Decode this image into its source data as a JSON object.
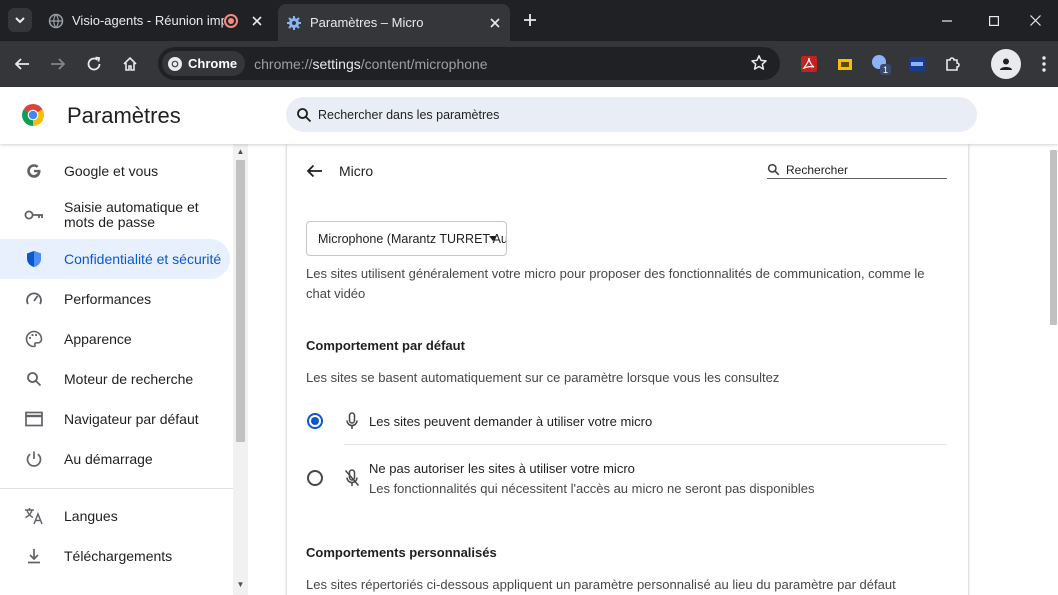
{
  "tabs": [
    {
      "title": "Visio-agents - Réunion impromptue",
      "recording": true
    },
    {
      "title": "Paramètres – Micro",
      "active": true
    }
  ],
  "omnibox": {
    "chip_label": "Chrome",
    "url_scheme": "chrome://",
    "url_host": "settings",
    "url_path": "/content/microphone"
  },
  "extensions": [
    "adobe-pdf",
    "notes",
    "badge-extension",
    "arc-extension",
    "puzzle"
  ],
  "extension_badge": "1",
  "settings": {
    "title": "Paramètres",
    "search_placeholder": "Rechercher dans les paramètres"
  },
  "sidebar": {
    "items": [
      {
        "label": "Google et vous",
        "icon": "google-g-icon"
      },
      {
        "label": "Saisie automatique et mots de passe",
        "icon": "key-icon"
      },
      {
        "label": "Confidentialité et sécurité",
        "icon": "shield-icon",
        "active": true
      },
      {
        "label": "Performances",
        "icon": "speedometer-icon"
      },
      {
        "label": "Apparence",
        "icon": "palette-icon"
      },
      {
        "label": "Moteur de recherche",
        "icon": "search-icon"
      },
      {
        "label": "Navigateur par défaut",
        "icon": "browser-window-icon"
      },
      {
        "label": "Au démarrage",
        "icon": "power-icon"
      },
      {
        "label": "Langues",
        "icon": "translate-icon"
      },
      {
        "label": "Téléchargements",
        "icon": "download-icon"
      }
    ]
  },
  "micro": {
    "title": "Micro",
    "search_placeholder": "Rechercher",
    "device": "Microphone (Marantz TURRET Audio)",
    "description": "Les sites utilisent généralement votre micro pour proposer des fonctionnalités de communication, comme le chat vidéo",
    "default_heading": "Comportement par défaut",
    "default_sub": "Les sites se basent automatiquement sur ce paramètre lorsque vous les consultez",
    "option_allow": "Les sites peuvent demander à utiliser votre micro",
    "option_block": "Ne pas autoriser les sites à utiliser votre micro",
    "option_block_sub": "Les fonctionnalités qui nécessitent l'accès au micro ne seront pas disponibles",
    "selected_option": "allow",
    "custom_heading": "Comportements personnalisés",
    "custom_sub": "Les sites répertoriés ci-dessous appliquent un paramètre personnalisé au lieu du paramètre par défaut"
  },
  "colors": {
    "accent": "#0b57d0",
    "active_nav_bg": "#e8f0fe",
    "chrome_dark": "#202124",
    "toolbar": "#35363a"
  }
}
